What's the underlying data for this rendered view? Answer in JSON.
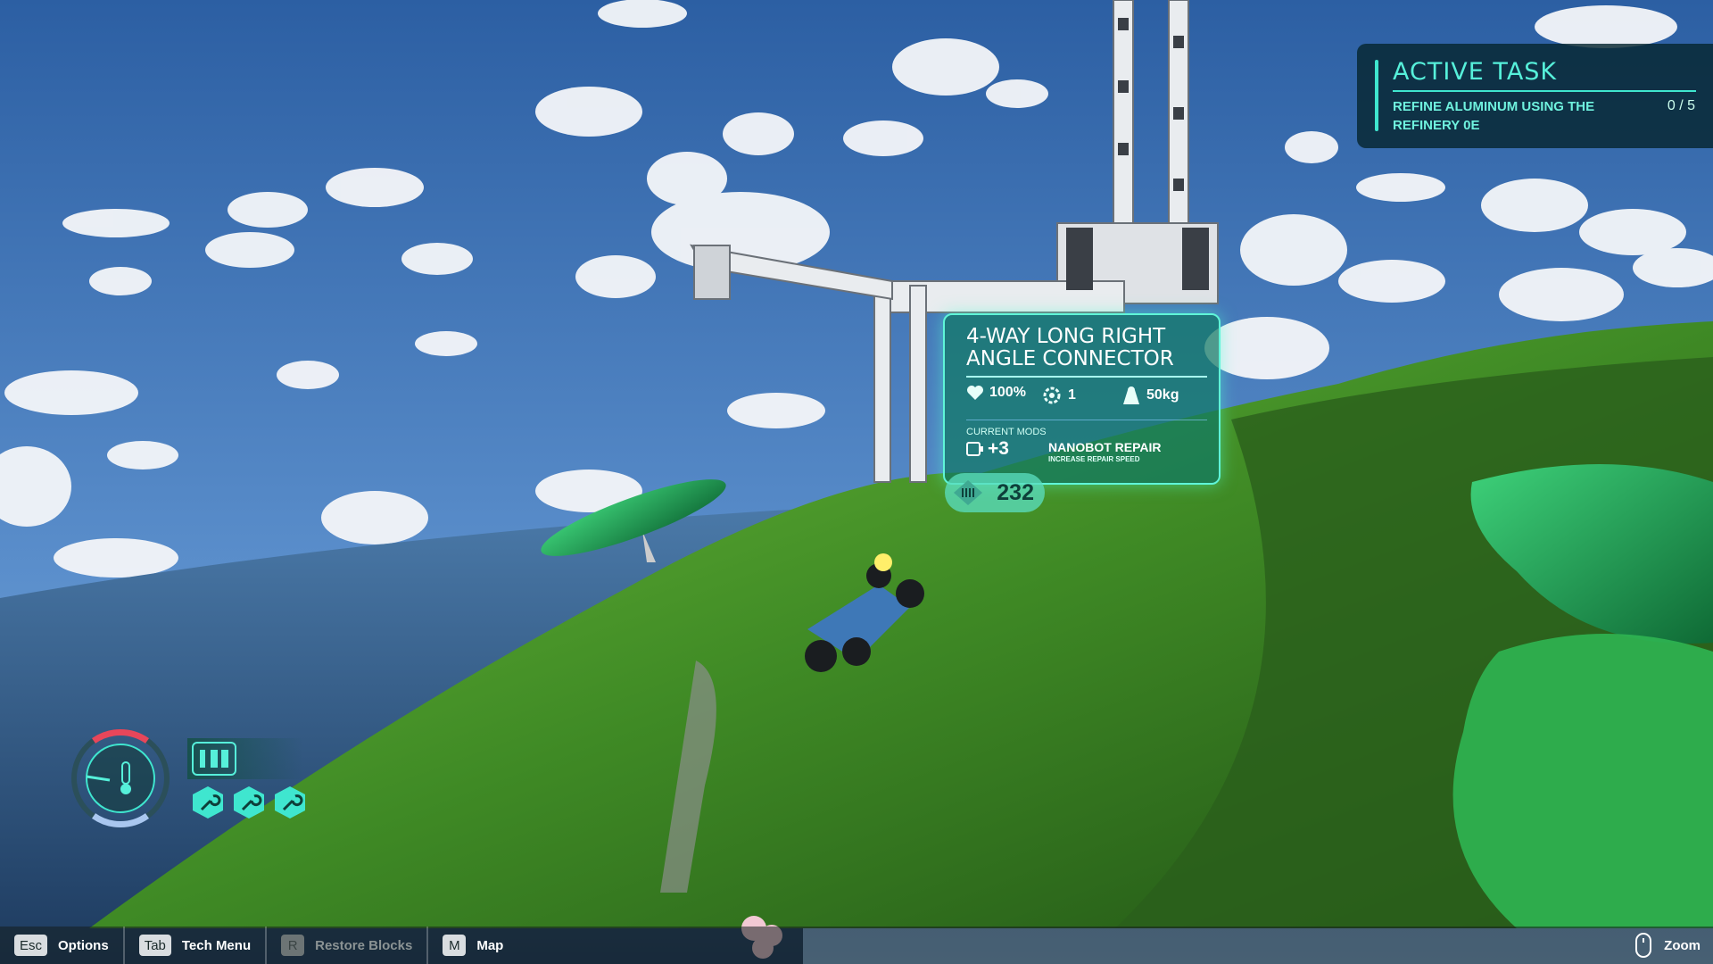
{
  "active_task": {
    "title": "ACTIVE TASK",
    "description": "REFINE ALUMINUM USING THE REFINERY 0E",
    "progress": "0 / 5"
  },
  "block_card": {
    "title": "4-WAY LONG RIGHT ANGLE CONNECTOR",
    "health": "100%",
    "connections": "1",
    "weight": "50kg",
    "mods_label": "CURRENT MODS",
    "mod_count": "+3",
    "mod_name": "NANOBOT REPAIR",
    "mod_description": "INCREASE REPAIR SPEED",
    "cost": "232"
  },
  "hud": {
    "gauge_icon": "thermometer-icon",
    "battery_icon": "battery-icon",
    "tool_icons": [
      "wrench-icon",
      "wrench-icon",
      "wrench-icon"
    ]
  },
  "bottom_bar": {
    "options": {
      "key": "Esc",
      "label": "Options"
    },
    "tech_menu": {
      "key": "Tab",
      "label": "Tech Menu"
    },
    "restore_blocks": {
      "key": "R",
      "label": "Restore Blocks"
    },
    "map": {
      "key": "M",
      "label": "Map"
    },
    "zoom": {
      "icon": "mouse-icon",
      "label": "Zoom"
    }
  },
  "colors": {
    "accent": "#56f0da",
    "panel": "#062630",
    "card": "#10786a"
  }
}
